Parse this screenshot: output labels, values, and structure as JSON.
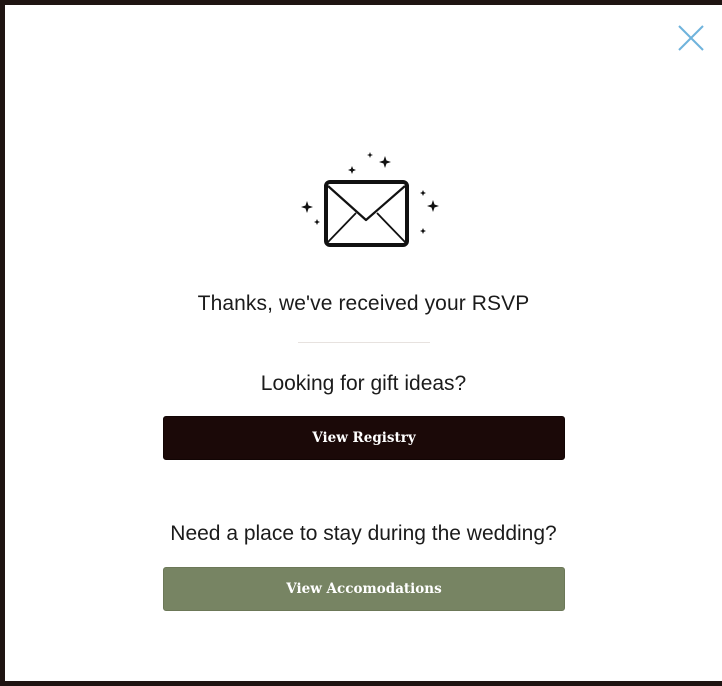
{
  "modal": {
    "close_icon": "close-icon",
    "illustration_icon": "envelope-sparkles-icon",
    "confirmation_text": "Thanks, we've received your RSVP",
    "gift_prompt": "Looking for gift ideas?",
    "registry_button_label": "View Registry",
    "stay_prompt": "Need a place to stay during the wedding?",
    "accommodations_button_label": "View Accomodations"
  },
  "colors": {
    "backdrop": "#1f1412",
    "close_icon": "#6fb3dc",
    "registry_button": "#1b0908",
    "accommodations_button": "#778463"
  }
}
